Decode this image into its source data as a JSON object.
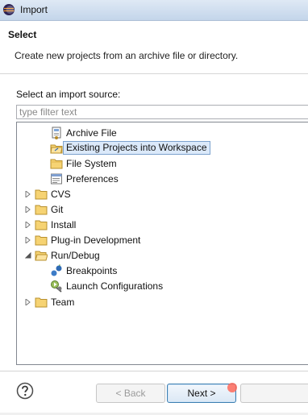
{
  "window": {
    "title": "Import",
    "icon": "eclipse-icon"
  },
  "header": {
    "title": "Select",
    "description": "Create new projects from an archive file or directory."
  },
  "import_source": {
    "label": "Select an import source:",
    "filter_placeholder": "type filter text"
  },
  "tree": {
    "general_children": [
      {
        "label": "Archive File",
        "icon": "archive-file-icon"
      },
      {
        "label": "Existing Projects into Workspace",
        "icon": "project-folder-icon",
        "selected": true
      },
      {
        "label": "File System",
        "icon": "folder-icon"
      },
      {
        "label": "Preferences",
        "icon": "preferences-icon"
      }
    ],
    "categories": [
      {
        "label": "CVS",
        "expanded": false
      },
      {
        "label": "Git",
        "expanded": false
      },
      {
        "label": "Install",
        "expanded": false
      },
      {
        "label": "Plug-in Development",
        "expanded": false
      },
      {
        "label": "Run/Debug",
        "expanded": true
      },
      {
        "label": "Team",
        "expanded": false
      }
    ],
    "run_debug_children": [
      {
        "label": "Breakpoints",
        "icon": "breakpoints-icon"
      },
      {
        "label": "Launch Configurations",
        "icon": "launch-configurations-icon"
      }
    ]
  },
  "buttons": {
    "back": "< Back",
    "next": "Next >"
  }
}
